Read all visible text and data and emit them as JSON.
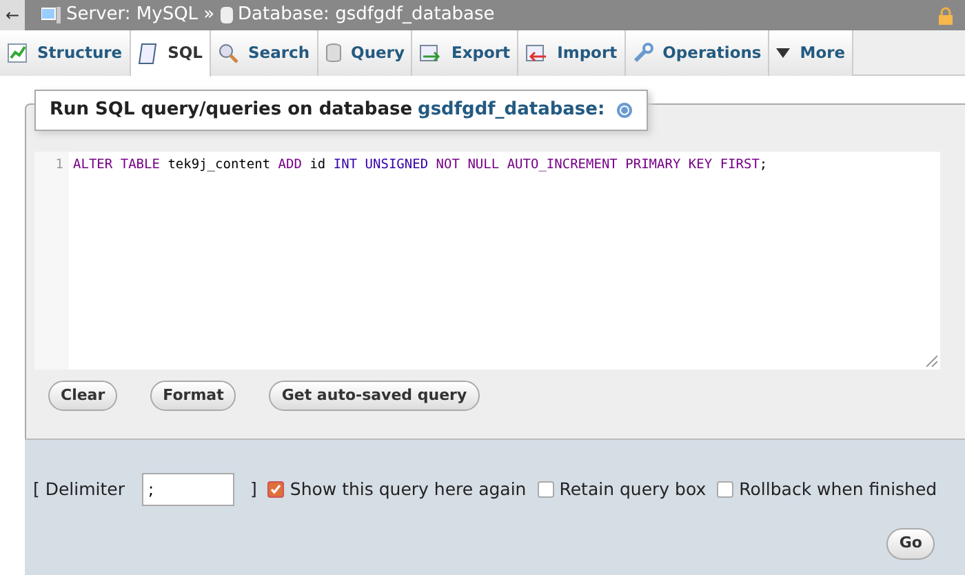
{
  "breadcrumb": {
    "back": "←",
    "server": "Server: MySQL",
    "separator": "»",
    "database": "Database: gsdfgdf_database"
  },
  "tabs": [
    {
      "label": "Structure",
      "kind": "structure",
      "selected": false
    },
    {
      "label": "SQL",
      "kind": "sql",
      "selected": true
    },
    {
      "label": "Search",
      "kind": "search",
      "selected": false
    },
    {
      "label": "Query",
      "kind": "query",
      "selected": false
    },
    {
      "label": "Export",
      "kind": "export",
      "selected": false
    },
    {
      "label": "Import",
      "kind": "import",
      "selected": false
    },
    {
      "label": "Operations",
      "kind": "operations",
      "selected": false
    },
    {
      "label": "More",
      "kind": "more",
      "selected": false
    }
  ],
  "panel": {
    "legend": "Run SQL query/queries on database",
    "database_link": "gsdfgdf_database:",
    "editor": {
      "line_number": "1",
      "tokens": [
        {
          "text": "ALTER",
          "kind": "keyword"
        },
        {
          "text": "TABLE",
          "kind": "keyword"
        },
        {
          "text": "tek9j_content",
          "kind": "name"
        },
        {
          "text": "ADD",
          "kind": "keyword"
        },
        {
          "text": "id",
          "kind": "name"
        },
        {
          "text": "INT",
          "kind": "type"
        },
        {
          "text": "UNSIGNED",
          "kind": "type"
        },
        {
          "text": "NOT",
          "kind": "keyword"
        },
        {
          "text": "NULL",
          "kind": "keyword"
        },
        {
          "text": "AUTO_INCREMENT",
          "kind": "keyword"
        },
        {
          "text": "PRIMARY",
          "kind": "keyword"
        },
        {
          "text": "KEY",
          "kind": "keyword"
        },
        {
          "text": "FIRST",
          "kind": "keyword"
        },
        {
          "text": ";",
          "kind": "punct"
        }
      ]
    },
    "buttons": [
      "Clear",
      "Format",
      "Get auto-saved query"
    ]
  },
  "options": {
    "delimiter_open": "[ Delimiter",
    "delimiter_value": ";",
    "delimiter_close": "]",
    "checkboxes": [
      {
        "label": "Show this query here again",
        "checked": true
      },
      {
        "label": "Retain query box",
        "checked": false
      },
      {
        "label": "Rollback when finished",
        "checked": false
      }
    ],
    "go": "Go"
  }
}
